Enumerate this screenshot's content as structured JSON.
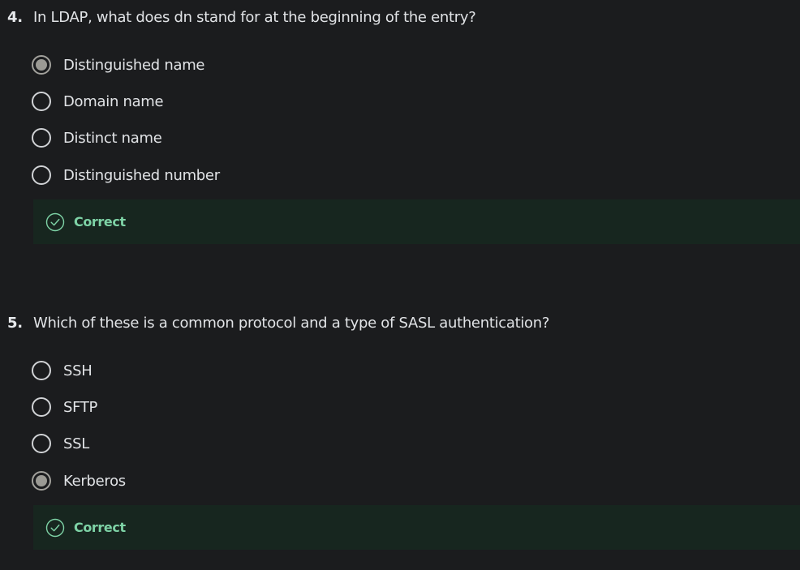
{
  "questions": [
    {
      "number": "4.",
      "text": "In LDAP, what does dn stand for at the beginning of the entry?",
      "options": [
        {
          "label": "Distinguished name",
          "selected": true
        },
        {
          "label": "Domain name",
          "selected": false
        },
        {
          "label": "Distinct name",
          "selected": false
        },
        {
          "label": "Distinguished number",
          "selected": false
        }
      ],
      "feedback": {
        "label": "Correct",
        "icon": "check-circle-icon"
      }
    },
    {
      "number": "5.",
      "text": "Which of these is a common protocol and a type of SASL authentication?",
      "options": [
        {
          "label": "SSH",
          "selected": false
        },
        {
          "label": "SFTP",
          "selected": false
        },
        {
          "label": "SSL",
          "selected": false
        },
        {
          "label": "Kerberos",
          "selected": true
        }
      ],
      "feedback": {
        "label": "Correct",
        "icon": "check-circle-icon"
      }
    }
  ],
  "colors": {
    "background": "#1b1c1e",
    "feedback_background": "#17261f",
    "correct_text": "#7ed3a6",
    "radio_border": "#d0d2d5",
    "radio_selected": "#9b9a94"
  }
}
